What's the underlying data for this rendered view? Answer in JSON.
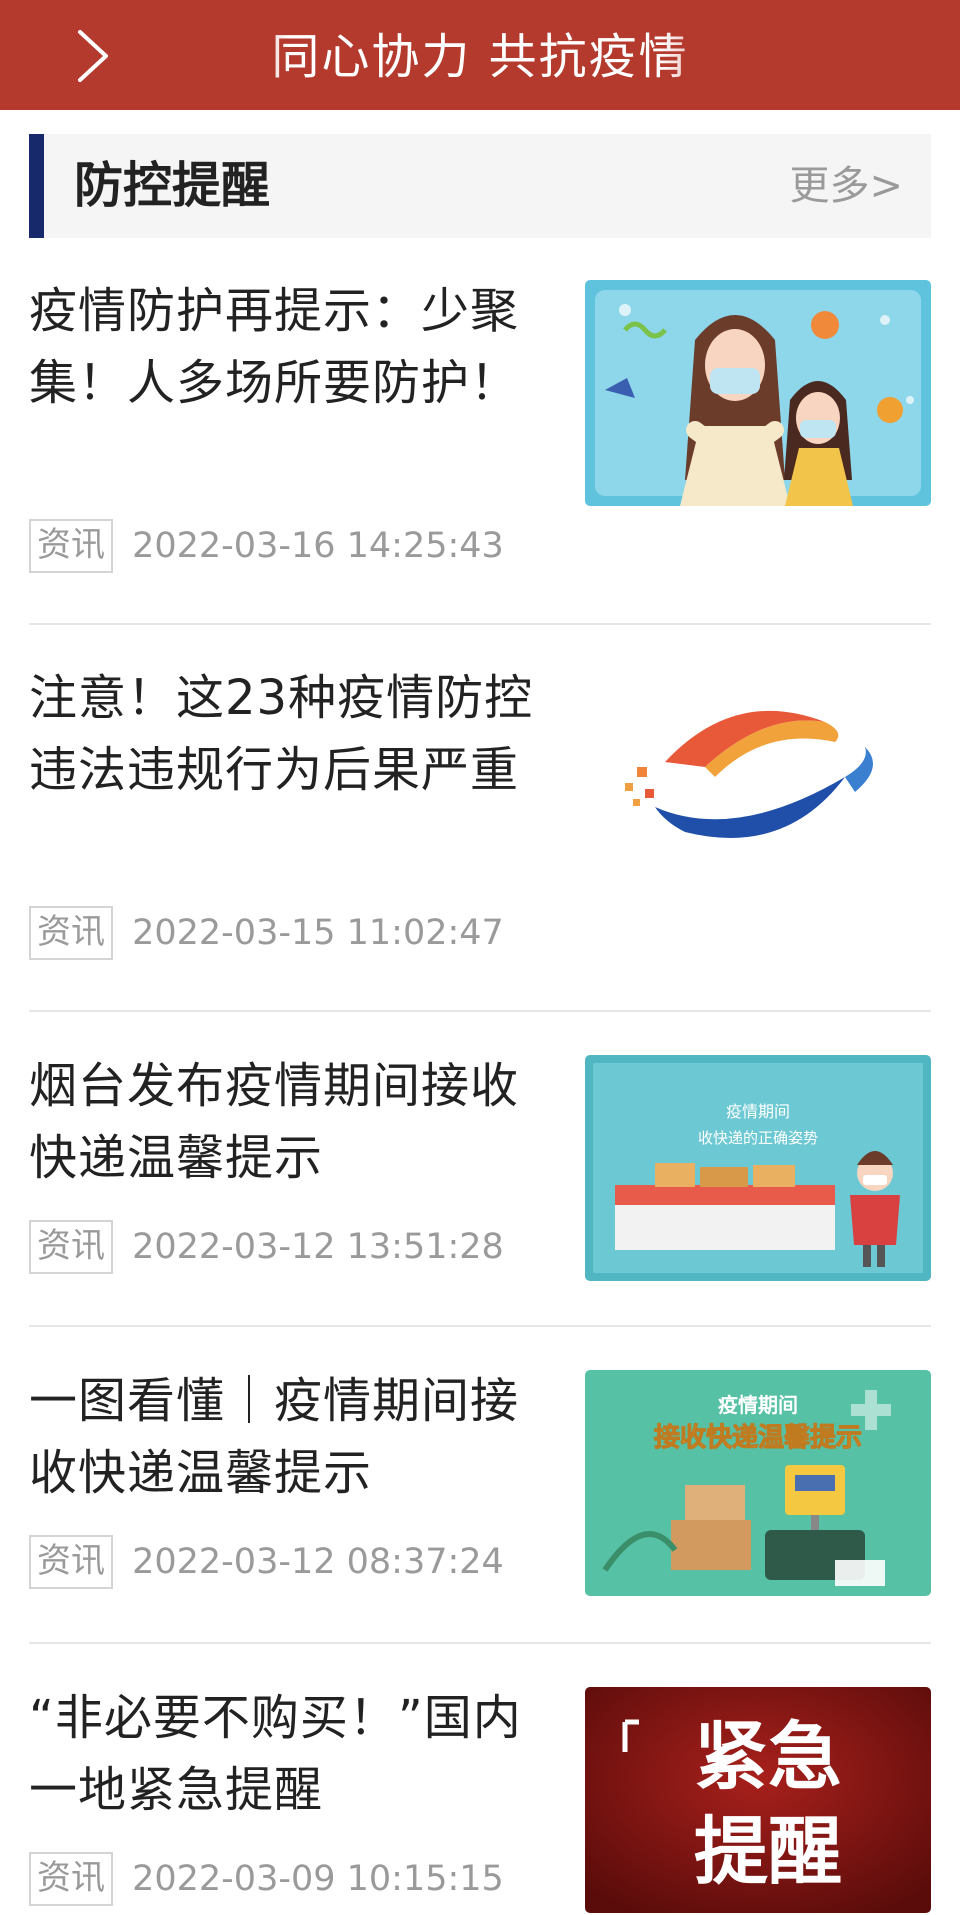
{
  "banner": {
    "text": "同心协力  共抗疫情",
    "bg_color": "#b53a2e",
    "back_icon": "chevron-right-icon"
  },
  "section": {
    "title": "防控提醒",
    "more_label": "更多>",
    "accent_color": "#17296b"
  },
  "news": [
    {
      "title": "疫情防护再提示：少聚集！人多场所要防护！",
      "tag": "资讯",
      "date": "2022-03-16 14:25:43",
      "thumb": "illustration-masked-girls"
    },
    {
      "title": "注意！这23种疫情防控违法违规行为后果严重",
      "tag": "资讯",
      "date": "2022-03-15 11:02:47",
      "thumb": "logo-swirl"
    },
    {
      "title": "烟台发布疫情期间接收快递温馨提示",
      "tag": "资讯",
      "date": "2022-03-12 13:51:28",
      "thumb": "illustration-parcel-pickup",
      "thumb_text": [
        "疫情期间",
        "收快递的正确姿势"
      ]
    },
    {
      "title": "一图看懂｜疫情期间接收快递温馨提示",
      "tag": "资讯",
      "date": "2022-03-12 08:37:24",
      "thumb": "illustration-parcel-locker",
      "thumb_text": [
        "疫情期间",
        "接收快递温馨提示"
      ]
    },
    {
      "title": "“非必要不购买！”国内一地紧急提醒",
      "tag": "资讯",
      "date": "2022-03-09 10:15:15",
      "thumb": "poster-urgent",
      "thumb_text": [
        "紧急",
        "提醒"
      ]
    }
  ]
}
